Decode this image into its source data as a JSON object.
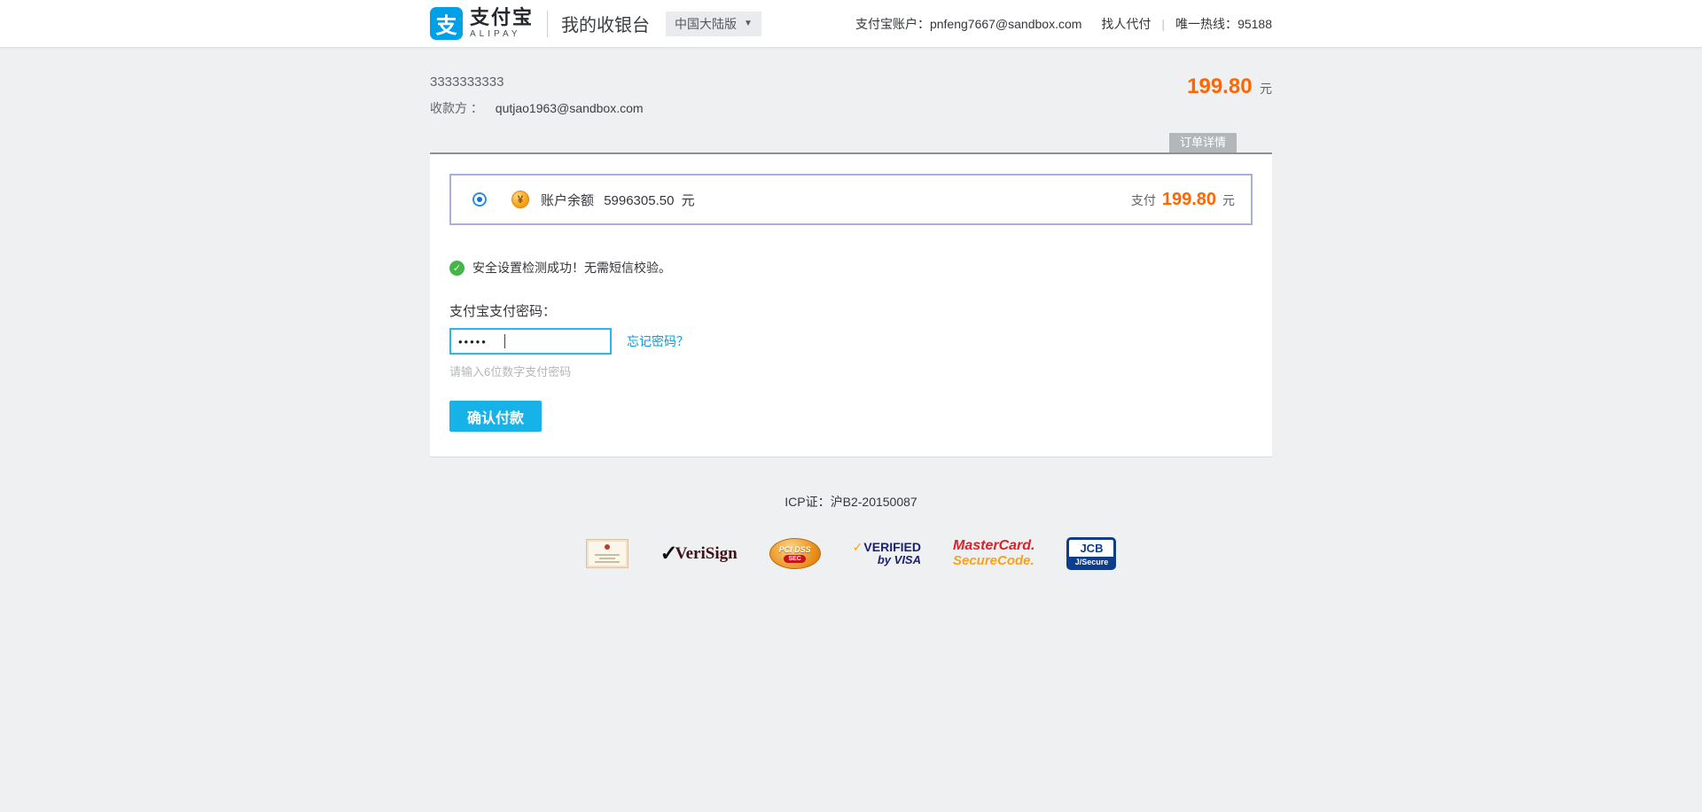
{
  "icons": {
    "caret_down": "▼",
    "check": "✓",
    "yuan": "¥",
    "logo_glyph": "支"
  },
  "header": {
    "brand_cn": "支付宝",
    "brand_en": "ALIPAY",
    "page_title": "我的收银台",
    "region_selector": "中国大陆版",
    "account_label": "支付宝账户：",
    "account_value": "pnfeng7667@sandbox.com",
    "pay_for_other": "找人代付",
    "separator": "|",
    "hotline_label": "唯一热线：",
    "hotline_value": "95188"
  },
  "order": {
    "order_no": "3333333333",
    "payee_label": "收款方 ：",
    "payee_value": "qutjao1963@sandbox.com",
    "amount": "199.80",
    "currency": "元",
    "details_tab": "订单详情"
  },
  "payment_method": {
    "balance_label": "账户余额",
    "balance_value": "5996305.50",
    "balance_currency": "元",
    "pay_label": "支付",
    "pay_amount": "199.80",
    "pay_currency": "元"
  },
  "security_notice": "安全设置检测成功！无需短信校验。",
  "password_section": {
    "label": "支付宝支付密码：",
    "masked_value": "•••••",
    "forgot_link": "忘记密码？",
    "hint": "请输入6位数字支付密码",
    "confirm_button": "确认付款"
  },
  "footer": {
    "icp_label": "ICP证：",
    "icp_value": "沪B2-20150087",
    "logos": [
      {
        "name": "business-license"
      },
      {
        "name": "verisign",
        "text": "VeriSign"
      },
      {
        "name": "pci-dss",
        "text": "PCI DSS",
        "badge": "SEC"
      },
      {
        "name": "verified-by-visa",
        "line1": "VERIFIED",
        "line2": "by VISA"
      },
      {
        "name": "mastercard-securecode",
        "line1": "MasterCard.",
        "line2": "SecureCode."
      },
      {
        "name": "jcb-jsecure",
        "line1": "JCB",
        "line2": "J/Secure"
      }
    ]
  },
  "colors": {
    "accent_orange": "#ff6600",
    "button_blue": "#17b2e8",
    "link_blue": "#00a0dc",
    "input_focus_border": "#29b8e8",
    "method_box_border": "#a6b2d8",
    "logo_blue": "#00a0e9",
    "success_green": "#44b549",
    "page_background": "#eef0f1",
    "tab_gray": "#b4b7b9"
  }
}
